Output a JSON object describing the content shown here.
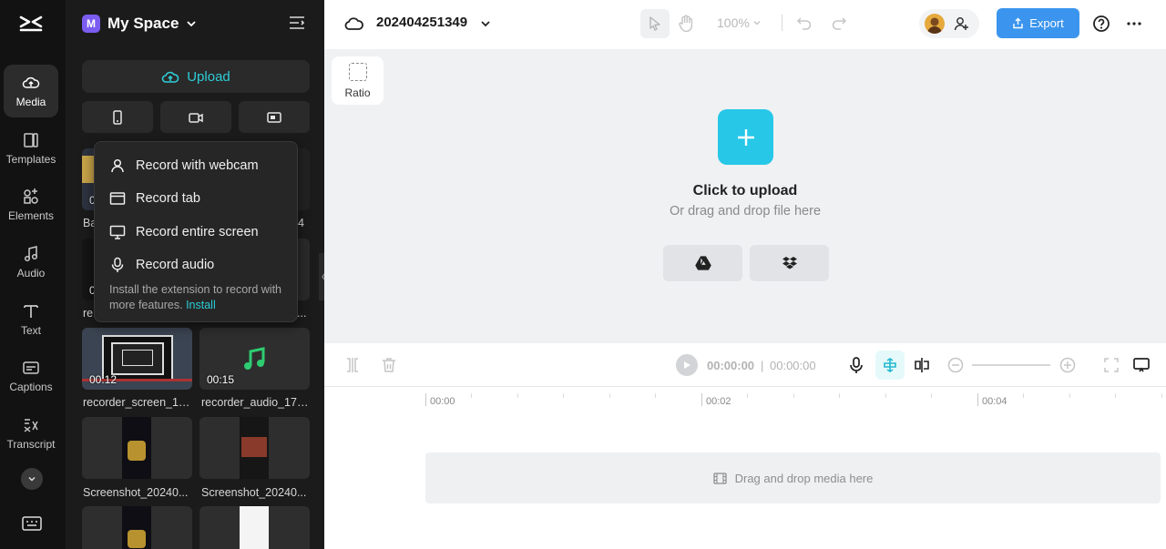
{
  "rail": {
    "items": [
      {
        "label": "Media",
        "icon": "media-cloud-icon"
      },
      {
        "label": "Templates",
        "icon": "templates-icon"
      },
      {
        "label": "Elements",
        "icon": "elements-icon"
      },
      {
        "label": "Audio",
        "icon": "music-note-icon"
      },
      {
        "label": "Text",
        "icon": "text-icon"
      },
      {
        "label": "Captions",
        "icon": "captions-icon"
      },
      {
        "label": "Transcript",
        "icon": "transcript-icon"
      }
    ]
  },
  "space": {
    "badge": "M",
    "name": "My Space"
  },
  "panel": {
    "upload_label": "Upload"
  },
  "record_menu": {
    "items": [
      "Record with webcam",
      "Record tab",
      "Record entire screen",
      "Record audio"
    ],
    "note": "Install the extension to record with more features.",
    "note_link": "Install"
  },
  "media_items": [
    {
      "name": "Ba",
      "duration": "0"
    },
    {
      "name": "4",
      "duration": ""
    },
    {
      "name": "re",
      "duration": "0"
    },
    {
      "name": "...",
      "duration": ""
    },
    {
      "name": "recorder_screen_17...",
      "duration": "00:12"
    },
    {
      "name": "recorder_audio_171...",
      "duration": "00:15"
    },
    {
      "name": "Screenshot_20240...",
      "duration": ""
    },
    {
      "name": "Screenshot_20240...",
      "duration": ""
    }
  ],
  "project": {
    "title": "202404251349"
  },
  "toolbar": {
    "zoom": "100%",
    "export_label": "Export"
  },
  "canvas": {
    "ratio_label": "Ratio",
    "upload_title": "Click to upload",
    "upload_sub": "Or drag and drop file here"
  },
  "timeline": {
    "current": "00:00:00",
    "separator": "|",
    "total": "00:00:00",
    "ruler": [
      "00:00",
      "00:02",
      "00:04"
    ],
    "track_hint": "Drag and drop media here"
  },
  "colors": {
    "accent": "#2ecdd8",
    "export": "#3b95ee",
    "upload_plus": "#27c7e8"
  }
}
